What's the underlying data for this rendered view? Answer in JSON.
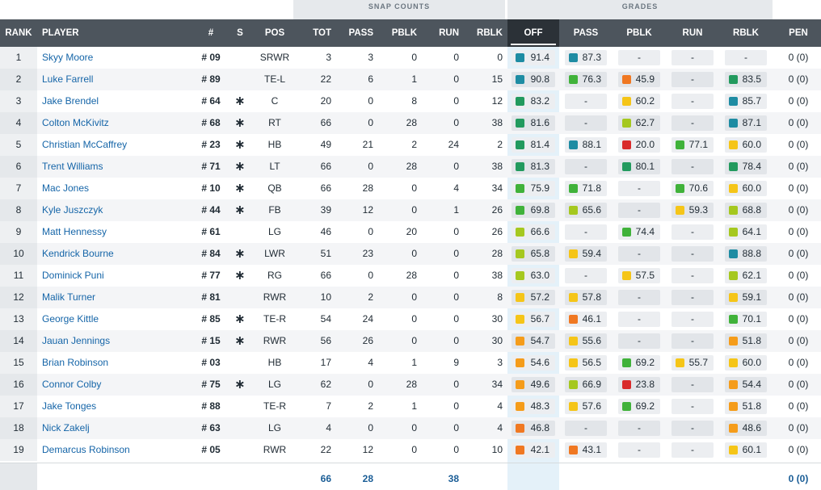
{
  "groups": {
    "snap": "SNAP COUNTS",
    "grades": "GRADES"
  },
  "headers": {
    "rank": "RANK",
    "player": "PLAYER",
    "num": "#",
    "s": "S",
    "pos": "POS",
    "tot": "TOT",
    "pass": "PASS",
    "pblk": "PBLK",
    "run": "RUN",
    "rblk": "RBLK",
    "g_off": "OFF",
    "g_pass": "PASS",
    "g_pblk": "PBLK",
    "g_run": "RUN",
    "g_rblk": "RBLK",
    "pen": "PEN"
  },
  "grade_colors": {
    "elite": "#1e8ca3",
    "high": "#229a5e",
    "good": "#40b23a",
    "above": "#a5c81f",
    "avg": "#f5c518",
    "below": "#f59c1a",
    "low": "#f07822",
    "poor": "#d92b2b"
  },
  "rows": [
    {
      "rank": "1",
      "name": "Skyy Moore",
      "num": "# 09",
      "s": "",
      "pos": "SRWR",
      "tot": "3",
      "pass": "3",
      "pblk": "0",
      "run": "0",
      "rblk": "0",
      "g_off": "91.4",
      "g_pass": "87.3",
      "g_pblk": "-",
      "g_run": "-",
      "g_rblk": "-",
      "pen": "0 (0)"
    },
    {
      "rank": "2",
      "name": "Luke Farrell",
      "num": "# 89",
      "s": "",
      "pos": "TE-L",
      "tot": "22",
      "pass": "6",
      "pblk": "1",
      "run": "0",
      "rblk": "15",
      "g_off": "90.8",
      "g_pass": "76.3",
      "g_pblk": "45.9",
      "g_run": "-",
      "g_rblk": "83.5",
      "pen": "0 (0)"
    },
    {
      "rank": "3",
      "name": "Jake Brendel",
      "num": "# 64",
      "s": "∗",
      "pos": "C",
      "tot": "20",
      "pass": "0",
      "pblk": "8",
      "run": "0",
      "rblk": "12",
      "g_off": "83.2",
      "g_pass": "-",
      "g_pblk": "60.2",
      "g_run": "-",
      "g_rblk": "85.7",
      "pen": "0 (0)"
    },
    {
      "rank": "4",
      "name": "Colton McKivitz",
      "num": "# 68",
      "s": "∗",
      "pos": "RT",
      "tot": "66",
      "pass": "0",
      "pblk": "28",
      "run": "0",
      "rblk": "38",
      "g_off": "81.6",
      "g_pass": "-",
      "g_pblk": "62.7",
      "g_run": "-",
      "g_rblk": "87.1",
      "pen": "0 (0)"
    },
    {
      "rank": "5",
      "name": "Christian McCaffrey",
      "num": "# 23",
      "s": "∗",
      "pos": "HB",
      "tot": "49",
      "pass": "21",
      "pblk": "2",
      "run": "24",
      "rblk": "2",
      "g_off": "81.4",
      "g_pass": "88.1",
      "g_pblk": "20.0",
      "g_run": "77.1",
      "g_rblk": "60.0",
      "pen": "0 (0)"
    },
    {
      "rank": "6",
      "name": "Trent Williams",
      "num": "# 71",
      "s": "∗",
      "pos": "LT",
      "tot": "66",
      "pass": "0",
      "pblk": "28",
      "run": "0",
      "rblk": "38",
      "g_off": "81.3",
      "g_pass": "-",
      "g_pblk": "80.1",
      "g_run": "-",
      "g_rblk": "78.4",
      "pen": "0 (0)"
    },
    {
      "rank": "7",
      "name": "Mac Jones",
      "num": "# 10",
      "s": "∗",
      "pos": "QB",
      "tot": "66",
      "pass": "28",
      "pblk": "0",
      "run": "4",
      "rblk": "34",
      "g_off": "75.9",
      "g_pass": "71.8",
      "g_pblk": "-",
      "g_run": "70.6",
      "g_rblk": "60.0",
      "pen": "0 (0)"
    },
    {
      "rank": "8",
      "name": "Kyle Juszczyk",
      "num": "# 44",
      "s": "∗",
      "pos": "FB",
      "tot": "39",
      "pass": "12",
      "pblk": "0",
      "run": "1",
      "rblk": "26",
      "g_off": "69.8",
      "g_pass": "65.6",
      "g_pblk": "-",
      "g_run": "59.3",
      "g_rblk": "68.8",
      "pen": "0 (0)"
    },
    {
      "rank": "9",
      "name": "Matt Hennessy",
      "num": "# 61",
      "s": "",
      "pos": "LG",
      "tot": "46",
      "pass": "0",
      "pblk": "20",
      "run": "0",
      "rblk": "26",
      "g_off": "66.6",
      "g_pass": "-",
      "g_pblk": "74.4",
      "g_run": "-",
      "g_rblk": "64.1",
      "pen": "0 (0)"
    },
    {
      "rank": "10",
      "name": "Kendrick Bourne",
      "num": "# 84",
      "s": "∗",
      "pos": "LWR",
      "tot": "51",
      "pass": "23",
      "pblk": "0",
      "run": "0",
      "rblk": "28",
      "g_off": "65.8",
      "g_pass": "59.4",
      "g_pblk": "-",
      "g_run": "-",
      "g_rblk": "88.8",
      "pen": "0 (0)"
    },
    {
      "rank": "11",
      "name": "Dominick Puni",
      "num": "# 77",
      "s": "∗",
      "pos": "RG",
      "tot": "66",
      "pass": "0",
      "pblk": "28",
      "run": "0",
      "rblk": "38",
      "g_off": "63.0",
      "g_pass": "-",
      "g_pblk": "57.5",
      "g_run": "-",
      "g_rblk": "62.1",
      "pen": "0 (0)"
    },
    {
      "rank": "12",
      "name": "Malik Turner",
      "num": "# 81",
      "s": "",
      "pos": "RWR",
      "tot": "10",
      "pass": "2",
      "pblk": "0",
      "run": "0",
      "rblk": "8",
      "g_off": "57.2",
      "g_pass": "57.8",
      "g_pblk": "-",
      "g_run": "-",
      "g_rblk": "59.1",
      "pen": "0 (0)"
    },
    {
      "rank": "13",
      "name": "George Kittle",
      "num": "# 85",
      "s": "∗",
      "pos": "TE-R",
      "tot": "54",
      "pass": "24",
      "pblk": "0",
      "run": "0",
      "rblk": "30",
      "g_off": "56.7",
      "g_pass": "46.1",
      "g_pblk": "-",
      "g_run": "-",
      "g_rblk": "70.1",
      "pen": "0 (0)"
    },
    {
      "rank": "14",
      "name": "Jauan Jennings",
      "num": "# 15",
      "s": "∗",
      "pos": "RWR",
      "tot": "56",
      "pass": "26",
      "pblk": "0",
      "run": "0",
      "rblk": "30",
      "g_off": "54.7",
      "g_pass": "55.6",
      "g_pblk": "-",
      "g_run": "-",
      "g_rblk": "51.8",
      "pen": "0 (0)"
    },
    {
      "rank": "15",
      "name": "Brian Robinson",
      "num": "# 03",
      "s": "",
      "pos": "HB",
      "tot": "17",
      "pass": "4",
      "pblk": "1",
      "run": "9",
      "rblk": "3",
      "g_off": "54.6",
      "g_pass": "56.5",
      "g_pblk": "69.2",
      "g_run": "55.7",
      "g_rblk": "60.0",
      "pen": "0 (0)"
    },
    {
      "rank": "16",
      "name": "Connor Colby",
      "num": "# 75",
      "s": "∗",
      "pos": "LG",
      "tot": "62",
      "pass": "0",
      "pblk": "28",
      "run": "0",
      "rblk": "34",
      "g_off": "49.6",
      "g_pass": "66.9",
      "g_pblk": "23.8",
      "g_run": "-",
      "g_rblk": "54.4",
      "pen": "0 (0)"
    },
    {
      "rank": "17",
      "name": "Jake Tonges",
      "num": "# 88",
      "s": "",
      "pos": "TE-R",
      "tot": "7",
      "pass": "2",
      "pblk": "1",
      "run": "0",
      "rblk": "4",
      "g_off": "48.3",
      "g_pass": "57.6",
      "g_pblk": "69.2",
      "g_run": "-",
      "g_rblk": "51.8",
      "pen": "0 (0)"
    },
    {
      "rank": "18",
      "name": "Nick Zakelj",
      "num": "# 63",
      "s": "",
      "pos": "LG",
      "tot": "4",
      "pass": "0",
      "pblk": "0",
      "run": "0",
      "rblk": "4",
      "g_off": "46.8",
      "g_pass": "-",
      "g_pblk": "-",
      "g_run": "-",
      "g_rblk": "48.6",
      "pen": "0 (0)"
    },
    {
      "rank": "19",
      "name": "Demarcus Robinson",
      "num": "# 05",
      "s": "",
      "pos": "RWR",
      "tot": "22",
      "pass": "12",
      "pblk": "0",
      "run": "0",
      "rblk": "10",
      "g_off": "42.1",
      "g_pass": "43.1",
      "g_pblk": "-",
      "g_run": "-",
      "g_rblk": "60.1",
      "pen": "0 (0)"
    }
  ],
  "totals": {
    "tot": "66",
    "pass": "28",
    "run": "38",
    "pen": "0 (0)"
  }
}
